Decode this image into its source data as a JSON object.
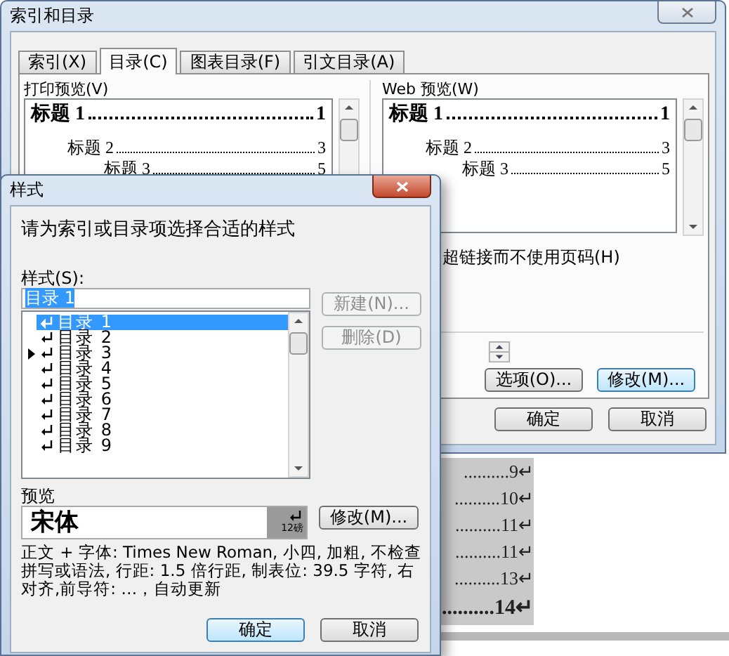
{
  "document": {
    "toc_lines": [
      {
        "text": "..........9↵",
        "kind": "plain"
      },
      {
        "text": "..........10↵",
        "kind": "plain"
      },
      {
        "text": "..........11↵",
        "kind": "plain"
      },
      {
        "text": "..........11↵",
        "kind": "plain"
      },
      {
        "text": "..........13↵",
        "kind": "plain"
      },
      {
        "text": "..........14↵",
        "kind": "bold"
      }
    ]
  },
  "index_dialog": {
    "title": "索引和目录",
    "tabs": [
      {
        "label": "索引(X)",
        "selected": false
      },
      {
        "label": "目录(C)",
        "selected": true
      },
      {
        "label": "图表目录(F)",
        "selected": false
      },
      {
        "label": "引文目录(A)",
        "selected": false
      }
    ],
    "print_preview": {
      "label": "打印预览(V)",
      "lines": [
        {
          "heading": "标题 1",
          "page": "1",
          "kind": "h1"
        },
        {
          "heading": "标题 2",
          "page": "3",
          "kind": "h2"
        },
        {
          "heading": "标题 3",
          "page": "5",
          "kind": "h3"
        }
      ]
    },
    "web_preview": {
      "label": "Web 预览(W)",
      "lines": [
        {
          "heading": "标题 1",
          "page": "1",
          "kind": "h1"
        },
        {
          "heading": "标题 2",
          "page": "3",
          "kind": "h2"
        },
        {
          "heading": "标题 3",
          "page": "5",
          "kind": "h3"
        }
      ]
    },
    "hyperlink_option": "超链接而不使用页码(H)",
    "buttons": [
      {
        "label": "选项(O)...",
        "kind": "normal"
      },
      {
        "label": "修改(M)...",
        "kind": "focused"
      }
    ],
    "footer_buttons": [
      "确定",
      "取消"
    ]
  },
  "style_dialog": {
    "title": "样式",
    "prompt": "请为索引或目录项选择合适的样式",
    "styles_label": "样式(S):",
    "style_field": {
      "value": "目录 1"
    },
    "styles": [
      {
        "label": "目录 1",
        "selected": true,
        "marked": false
      },
      {
        "label": "目录 2",
        "selected": false,
        "marked": false
      },
      {
        "label": "目录 3",
        "selected": false,
        "marked": true
      },
      {
        "label": "目录 4",
        "selected": false,
        "marked": false
      },
      {
        "label": "目录 5",
        "selected": false,
        "marked": false
      },
      {
        "label": "目录 6",
        "selected": false,
        "marked": false
      },
      {
        "label": "目录 7",
        "selected": false,
        "marked": false
      },
      {
        "label": "目录 8",
        "selected": false,
        "marked": false
      },
      {
        "label": "目录 9",
        "selected": false,
        "marked": false
      }
    ],
    "side_buttons": [
      {
        "label": "新建(N)...",
        "disabled": true
      },
      {
        "label": "删除(D)",
        "disabled": true
      }
    ],
    "preview_label": "预览",
    "preview": {
      "font": "宋体",
      "size": "12磅"
    },
    "modify_button": "修改(M)...",
    "description": "正文 + 字体: Times New Roman, 小四, 加粗, 不检查拼写或语法, 行距: 1.5 倍行距, 制表位:  39.5 字符, 右对齐,前导符: …，自动更新",
    "buttons": [
      {
        "label": "确定",
        "kind": "default"
      },
      {
        "label": "取消",
        "kind": "normal"
      }
    ]
  }
}
